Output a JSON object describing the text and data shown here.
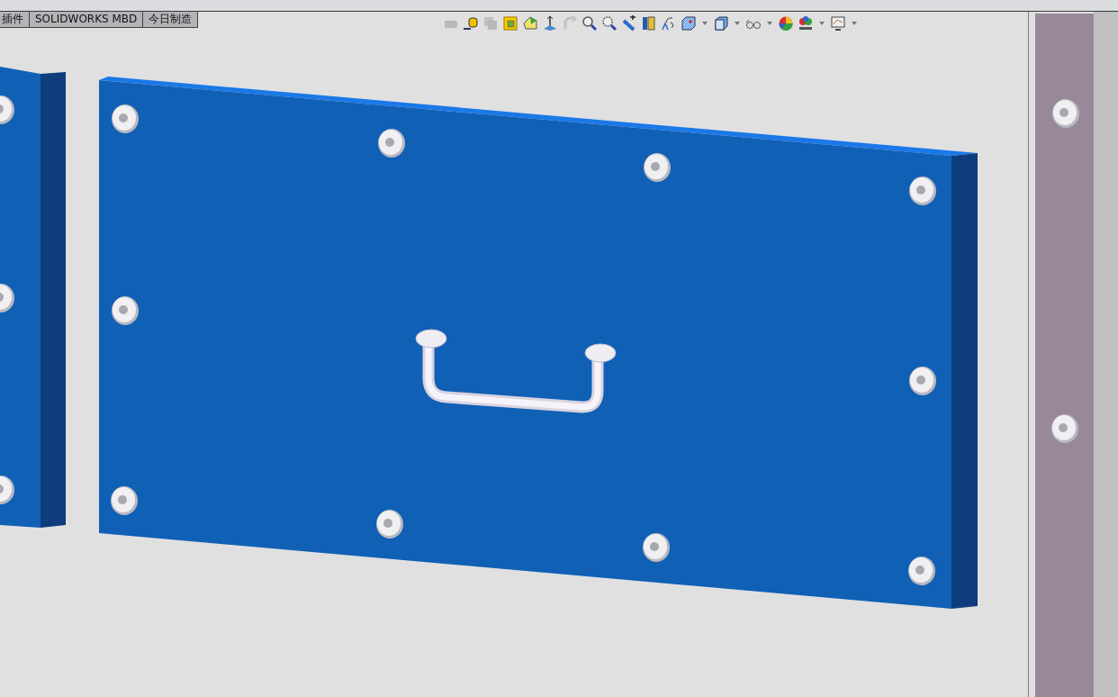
{
  "tabs": [
    {
      "label": "插件"
    },
    {
      "label": "SOLIDWORKS MBD"
    },
    {
      "label": "今日制造"
    }
  ],
  "toolbar": [
    {
      "kind": "shapes",
      "disabled": true,
      "dropdown": false
    },
    {
      "kind": "measure",
      "disabled": false,
      "dropdown": false
    },
    {
      "kind": "stack",
      "disabled": true,
      "dropdown": false
    },
    {
      "kind": "frame",
      "disabled": false,
      "dropdown": false
    },
    {
      "kind": "solid",
      "disabled": false,
      "dropdown": false
    },
    {
      "kind": "axis",
      "disabled": false,
      "dropdown": false
    },
    {
      "kind": "redo",
      "disabled": true,
      "dropdown": false
    },
    {
      "kind": "zoom",
      "disabled": false,
      "dropdown": false
    },
    {
      "kind": "zoomarea",
      "disabled": false,
      "dropdown": false
    },
    {
      "kind": "wand",
      "disabled": false,
      "dropdown": false
    },
    {
      "kind": "section",
      "disabled": false,
      "dropdown": false
    },
    {
      "kind": "orient",
      "disabled": false,
      "dropdown": false
    },
    {
      "kind": "cubeview",
      "disabled": false,
      "dropdown": true
    },
    {
      "kind": "cube",
      "disabled": false,
      "dropdown": true
    },
    {
      "kind": "glasses",
      "disabled": false,
      "dropdown": true
    },
    {
      "kind": "ball",
      "disabled": false,
      "dropdown": false
    },
    {
      "kind": "scene",
      "disabled": false,
      "dropdown": true
    },
    {
      "kind": "monitor",
      "disabled": false,
      "dropdown": true
    }
  ]
}
